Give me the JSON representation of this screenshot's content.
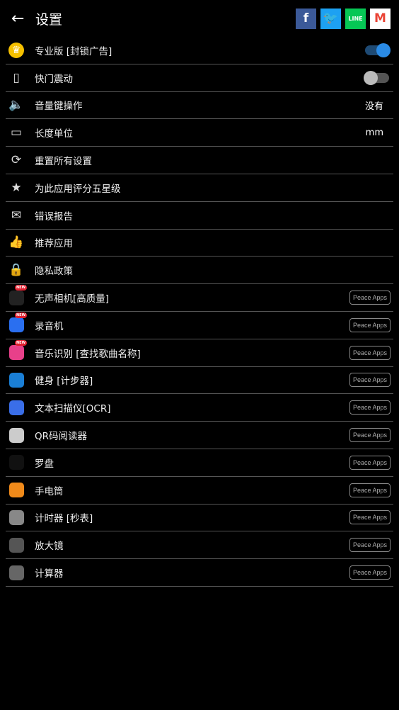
{
  "header": {
    "title": "设置",
    "back_icon": "arrow-left-icon",
    "social": [
      "facebook",
      "twitter",
      "line",
      "gmail"
    ]
  },
  "settings": [
    {
      "icon": "crown-icon",
      "label": "专业版 [封锁广告]",
      "toggle": true
    },
    {
      "icon": "vibrate-icon",
      "label": "快门震动",
      "toggle": false
    },
    {
      "icon": "volume-icon",
      "label": "音量键操作",
      "value": "没有"
    },
    {
      "icon": "ruler-icon",
      "label": "长度单位",
      "value": "mm"
    },
    {
      "icon": "reset-icon",
      "label": "重置所有设置"
    },
    {
      "icon": "star-icon",
      "label": "为此应用评分五星级"
    },
    {
      "icon": "mail-icon",
      "label": "错误报告"
    },
    {
      "icon": "thumbs-up-icon",
      "label": "推荐应用"
    },
    {
      "icon": "lock-icon",
      "label": "隐私政策"
    }
  ],
  "new_badge": "NEW",
  "publisher": "Peace Apps",
  "apps": [
    {
      "label": "无声相机[高质量]",
      "color": "#222",
      "new": true
    },
    {
      "label": "录音机",
      "color": "#2a6ff0",
      "new": true
    },
    {
      "label": "音乐识别 [查找歌曲名称]",
      "color": "#e8408a",
      "new": true
    },
    {
      "label": "健身 [计步器]",
      "color": "#1a7fd6",
      "new": false
    },
    {
      "label": "文本扫描仪[OCR]",
      "color": "#3a6ee8",
      "new": false
    },
    {
      "label": "QR码阅读器",
      "color": "#ccc",
      "new": false
    },
    {
      "label": "罗盘",
      "color": "#111",
      "new": false
    },
    {
      "label": "手电筒",
      "color": "#f08a1a",
      "new": false
    },
    {
      "label": "计时器 [秒表]",
      "color": "#888",
      "new": false
    },
    {
      "label": "放大镜",
      "color": "#555",
      "new": false
    },
    {
      "label": "计算器",
      "color": "#666",
      "new": false
    }
  ]
}
